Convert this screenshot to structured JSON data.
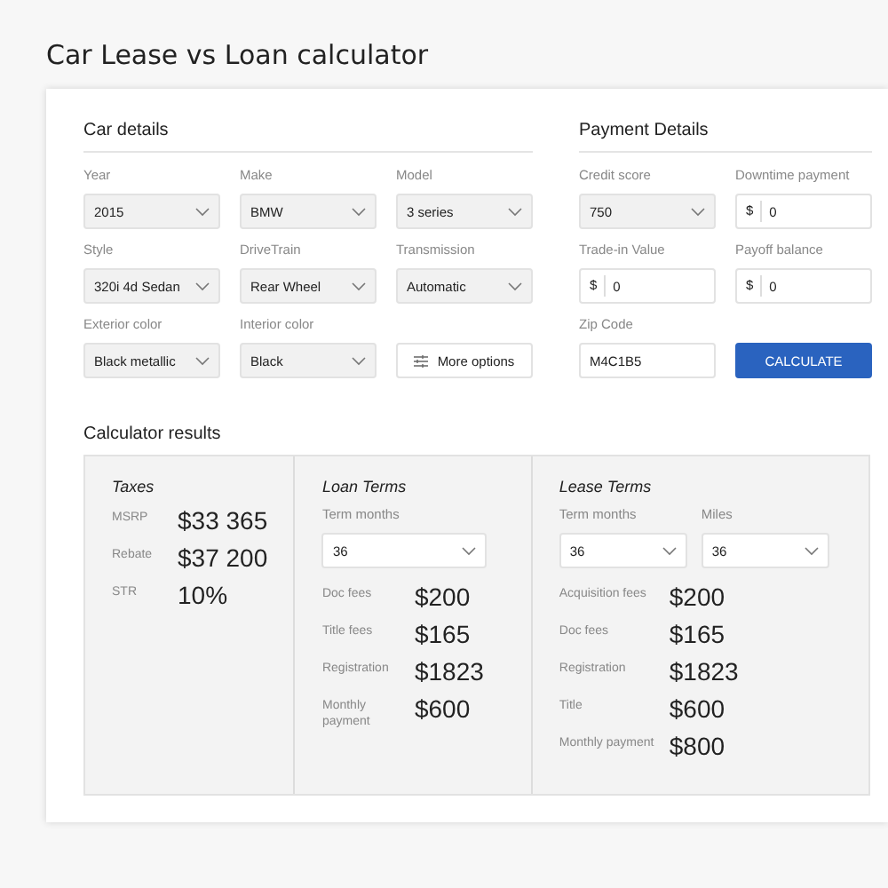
{
  "title": "Car Lease vs Loan calculator",
  "car_details": {
    "heading": "Car details",
    "fields": [
      {
        "kind": "select",
        "label": "Year",
        "value": "2015"
      },
      {
        "kind": "select",
        "label": "Make",
        "value": "BMW"
      },
      {
        "kind": "select",
        "label": "Model",
        "value": "3 series"
      },
      {
        "kind": "select",
        "label": "Style",
        "value": "320i 4d Sedan"
      },
      {
        "kind": "select",
        "label": "DriveTrain",
        "value": "Rear Wheel"
      },
      {
        "kind": "select",
        "label": "Transmission",
        "value": "Automatic"
      },
      {
        "kind": "select",
        "label": "Exterior color",
        "value": "Black metallic"
      },
      {
        "kind": "select",
        "label": "Interior color",
        "value": "Black"
      },
      {
        "kind": "options",
        "text": "More options"
      }
    ]
  },
  "payment_details": {
    "heading": "Payment Details",
    "fields": [
      {
        "kind": "select",
        "label": "Credit score",
        "value": "750"
      },
      {
        "kind": "currency",
        "label": "Downtime payment",
        "prefix": "$",
        "value": "0"
      },
      {
        "kind": "currency",
        "label": "Trade-in Value",
        "prefix": "$",
        "value": "0"
      },
      {
        "kind": "currency",
        "label": "Payoff balance",
        "prefix": "$",
        "value": "0"
      },
      {
        "kind": "text",
        "label": "Zip Code",
        "value": "M4C1B5"
      },
      {
        "kind": "primary",
        "text": "CALCULATE"
      }
    ]
  },
  "results": {
    "heading": "Calculator results",
    "panels": [
      {
        "title": "Taxes",
        "rows": [
          {
            "label": "MSRP",
            "value": "$33 365"
          },
          {
            "label": "Rebate",
            "value": "$37 200"
          },
          {
            "label": "STR",
            "value": "10%"
          }
        ]
      },
      {
        "title": "Loan Terms",
        "selects": [
          {
            "label": "Term months",
            "value": "36"
          }
        ],
        "rows": [
          {
            "label": "Doc fees",
            "value": "$200"
          },
          {
            "label": "Title fees",
            "value": "$165"
          },
          {
            "label": "Registration",
            "value": "$1823"
          },
          {
            "label": "Monthly payment",
            "value": "$600"
          }
        ]
      },
      {
        "title": "Lease Terms",
        "selects": [
          {
            "label": "Term months",
            "value": "36"
          },
          {
            "label": "Miles",
            "value": "36"
          }
        ],
        "rows": [
          {
            "label": "Acquisition fees",
            "value": "$200"
          },
          {
            "label": "Doc fees",
            "value": "$165"
          },
          {
            "label": "Registration",
            "value": "$1823"
          },
          {
            "label": "Title",
            "value": "$600"
          },
          {
            "label": "Monthly payment",
            "value": "$800"
          }
        ]
      }
    ]
  }
}
